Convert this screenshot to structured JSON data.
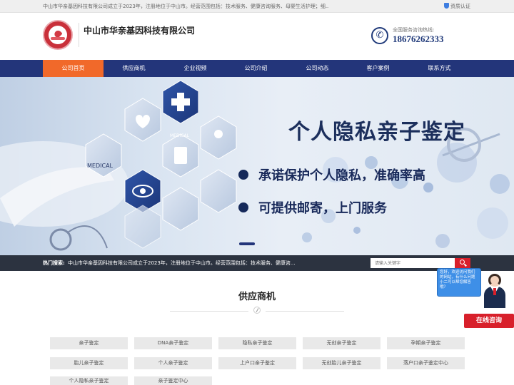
{
  "topbar": {
    "intro": "中山市华亲基因科技有限公司成立于2023年，注册地位于中山市。经营范围包括：技术服务、健康咨询服务、母婴生活护理；细...",
    "cert_label": "资质认证"
  },
  "header": {
    "company_name": "中山市华亲基因科技有限公司",
    "hotline_label": "全国服务咨询热线:",
    "hotline_number": "18676262333"
  },
  "nav": {
    "items": [
      {
        "label": "公司首页",
        "active": true
      },
      {
        "label": "供应商机",
        "active": false
      },
      {
        "label": "企业视频",
        "active": false
      },
      {
        "label": "公司介绍",
        "active": false
      },
      {
        "label": "公司动态",
        "active": false
      },
      {
        "label": "客户案例",
        "active": false
      },
      {
        "label": "联系方式",
        "active": false
      }
    ]
  },
  "banner": {
    "headline": "个人隐私亲子鉴定",
    "points": [
      "承诺保护个人隐私，准确率高",
      "可提供邮寄，上门服务"
    ],
    "sign_text": "MEDICAL",
    "hex_text": "MEDICAL"
  },
  "hotbar": {
    "label": "热门搜索:",
    "text": "中山市华亲基因科技有限公司成立于2023年，注册地位于中山市。经营范围包括：技术服务、健康咨...",
    "search_placeholder": "请输入关键字"
  },
  "section": {
    "title": "供应商机",
    "tags": [
      "亲子鉴定",
      "DNA亲子鉴定",
      "隐私亲子鉴定",
      "无创亲子鉴定",
      "孕期亲子鉴定",
      "胎儿亲子鉴定",
      "个人亲子鉴定",
      "上户口亲子鉴定",
      "无创胎儿亲子鉴定",
      "落户口亲子鉴定中心",
      "个人隐私亲子鉴定",
      "亲子鉴定中心"
    ]
  },
  "chat": {
    "bubble_text": "您好，欢迎访问我们的网站，有什么问题小二可以帮您解答哦？",
    "button_label": "在线咨询"
  },
  "colors": {
    "nav_bg": "#23357a",
    "nav_active": "#f1692a",
    "accent_red": "#d8202b",
    "hotline_blue": "#203a7a"
  }
}
